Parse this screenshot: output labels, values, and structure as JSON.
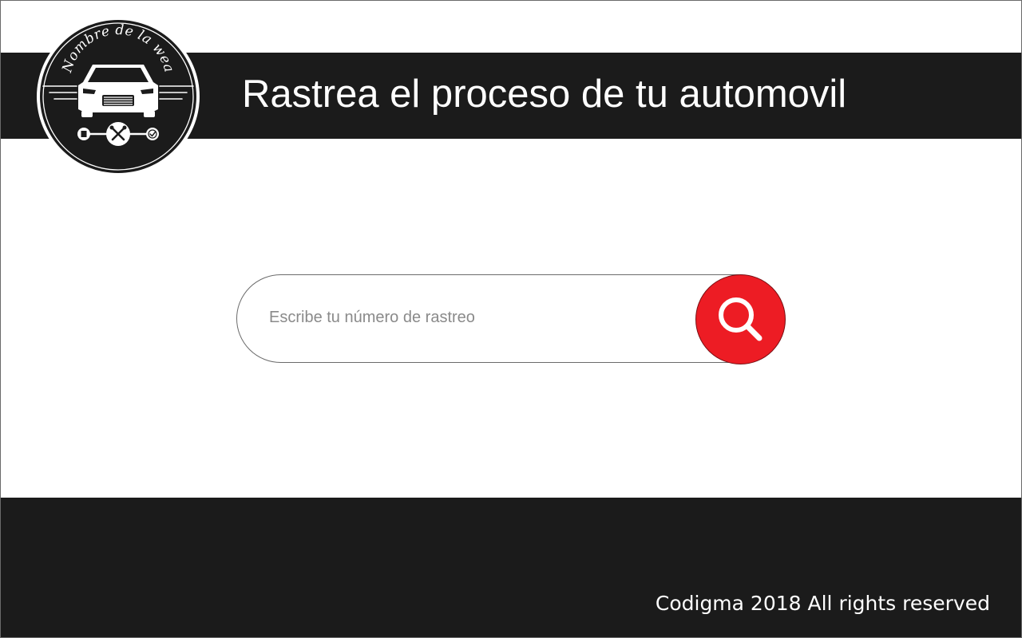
{
  "header": {
    "title": "Rastrea el proceso de tu automovil",
    "logo": {
      "text": "Nombre de la wea",
      "icons": [
        "car-icon",
        "clipboard-icon",
        "tools-icon",
        "check-icon"
      ]
    }
  },
  "search": {
    "placeholder": "Escribe tu número de rastreo",
    "value": "",
    "button_icon": "search-icon"
  },
  "footer": {
    "text": "Codigma 2018 All rights reserved"
  },
  "colors": {
    "dark_bar": "#1b1b1b",
    "accent": "#ed1c24",
    "background": "#ffffff"
  }
}
